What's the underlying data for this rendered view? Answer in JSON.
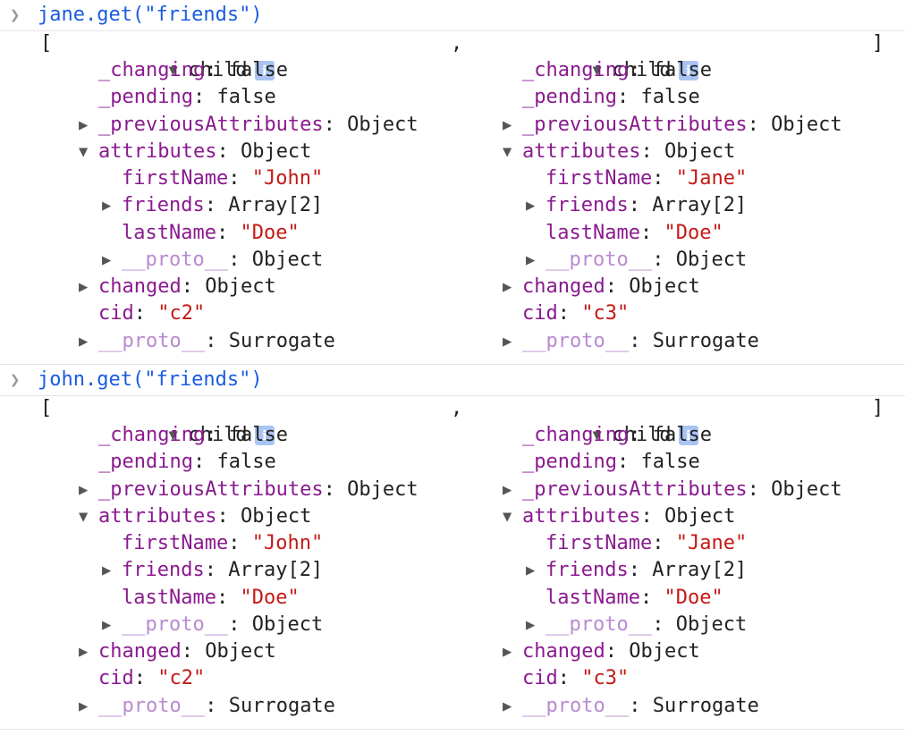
{
  "console": {
    "entries": [
      {
        "command": "jane.get(\"friends\")",
        "result": {
          "open_bracket": "[",
          "separator": ",",
          "close_bracket": "]",
          "objects": [
            {
              "label": "child",
              "info": "i",
              "changing_key": "_changing",
              "changing_val": "false",
              "pending_key": "_pending",
              "pending_val": "false",
              "prev_key": "_previousAttributes",
              "prev_val": "Object",
              "attrs_key": "attributes",
              "attrs_val": "Object",
              "first_key": "firstName",
              "first_val": "\"John\"",
              "friends_key": "friends",
              "friends_val": "Array[2]",
              "last_key": "lastName",
              "last_val": "\"Doe\"",
              "aproto_key": "__proto__",
              "aproto_val": "Object",
              "changed_key": "changed",
              "changed_val": "Object",
              "cid_key": "cid",
              "cid_val": "\"c2\"",
              "proto_key": "__proto__",
              "proto_val": "Surrogate"
            },
            {
              "label": "child",
              "info": "i",
              "changing_key": "_changing",
              "changing_val": "false",
              "pending_key": "_pending",
              "pending_val": "false",
              "prev_key": "_previousAttributes",
              "prev_val": "Object",
              "attrs_key": "attributes",
              "attrs_val": "Object",
              "first_key": "firstName",
              "first_val": "\"Jane\"",
              "friends_key": "friends",
              "friends_val": "Array[2]",
              "last_key": "lastName",
              "last_val": "\"Doe\"",
              "aproto_key": "__proto__",
              "aproto_val": "Object",
              "changed_key": "changed",
              "changed_val": "Object",
              "cid_key": "cid",
              "cid_val": "\"c3\"",
              "proto_key": "__proto__",
              "proto_val": "Surrogate"
            }
          ]
        }
      },
      {
        "command": "john.get(\"friends\")",
        "result": {
          "open_bracket": "[",
          "separator": ",",
          "close_bracket": "]",
          "objects": [
            {
              "label": "child",
              "info": "i",
              "changing_key": "_changing",
              "changing_val": "false",
              "pending_key": "_pending",
              "pending_val": "false",
              "prev_key": "_previousAttributes",
              "prev_val": "Object",
              "attrs_key": "attributes",
              "attrs_val": "Object",
              "first_key": "firstName",
              "first_val": "\"John\"",
              "friends_key": "friends",
              "friends_val": "Array[2]",
              "last_key": "lastName",
              "last_val": "\"Doe\"",
              "aproto_key": "__proto__",
              "aproto_val": "Object",
              "changed_key": "changed",
              "changed_val": "Object",
              "cid_key": "cid",
              "cid_val": "\"c2\"",
              "proto_key": "__proto__",
              "proto_val": "Surrogate"
            },
            {
              "label": "child",
              "info": "i",
              "changing_key": "_changing",
              "changing_val": "false",
              "pending_key": "_pending",
              "pending_val": "false",
              "prev_key": "_previousAttributes",
              "prev_val": "Object",
              "attrs_key": "attributes",
              "attrs_val": "Object",
              "first_key": "firstName",
              "first_val": "\"Jane\"",
              "friends_key": "friends",
              "friends_val": "Array[2]",
              "last_key": "lastName",
              "last_val": "\"Doe\"",
              "aproto_key": "__proto__",
              "aproto_val": "Object",
              "changed_key": "changed",
              "changed_val": "Object",
              "cid_key": "cid",
              "cid_val": "\"c3\"",
              "proto_key": "__proto__",
              "proto_val": "Surrogate"
            }
          ]
        }
      }
    ]
  }
}
